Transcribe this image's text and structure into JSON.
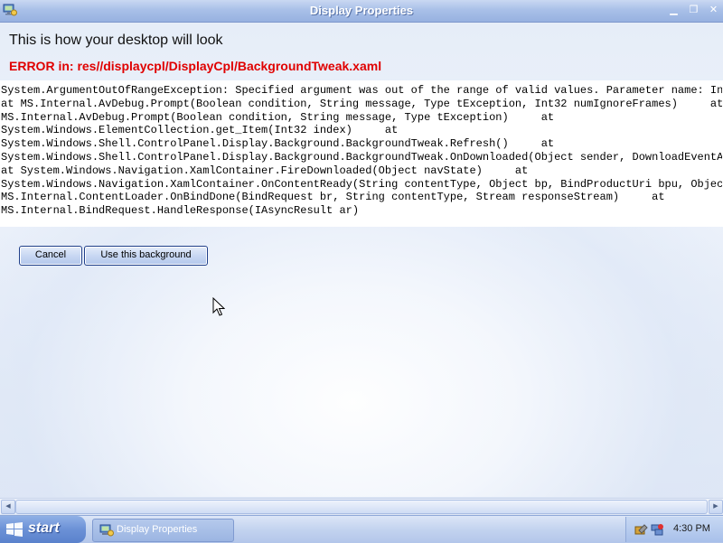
{
  "window": {
    "title": "Display Properties",
    "icon": "display-properties-icon",
    "controls": {
      "minimize_icon": "minimize-icon",
      "maximize_icon": "maximize-icon",
      "close_icon": "close-icon",
      "minimize_glyph": "▁",
      "maximize_glyph": "❐",
      "close_glyph": "✕"
    }
  },
  "main": {
    "heading": "This is how your desktop will look",
    "error_title": "ERROR in: res//displaycpl/DisplayCpl/BackgroundTweak.xaml",
    "stack_trace_lines": [
      "System.ArgumentOutOfRangeException: Specified argument was out of the range of valid values. Parameter name: Index out of range",
      "at MS.Internal.AvDebug.Prompt(Boolean condition, String message, Type tException, Int32 numIgnoreFrames)     at",
      "MS.Internal.AvDebug.Prompt(Boolean condition, String message, Type tException)     at",
      "System.Windows.ElementCollection.get_Item(Int32 index)     at",
      "System.Windows.Shell.ControlPanel.Display.Background.BackgroundTweak.Refresh()     at",
      "System.Windows.Shell.ControlPanel.Display.Background.BackgroundTweak.OnDownloaded(Object sender, DownloadEventArgs args)",
      "at System.Windows.Navigation.XamlContainer.FireDownloaded(Object navState)     at",
      "System.Windows.Navigation.XamlContainer.OnContentReady(String contentType, Object bp, BindProductUri bpu, Object navState)     at",
      "MS.Internal.ContentLoader.OnBindDone(BindRequest br, String contentType, Stream responseStream)     at",
      "MS.Internal.BindRequest.HandleResponse(IAsyncResult ar)"
    ],
    "buttons": {
      "cancel": "Cancel",
      "use_background": "Use this background"
    }
  },
  "scrollbar": {
    "left_arrow": "◀",
    "right_arrow": "▶"
  },
  "taskbar": {
    "start_label": "start",
    "start_icon": "windows-logo-icon",
    "task_button_label": "Display Properties",
    "task_button_icon": "display-properties-icon",
    "tray_icons": [
      "hardware-icon",
      "network-icon"
    ],
    "clock": "4:30 PM"
  },
  "colors": {
    "error_red": "#e00000",
    "titlebar_blue": "#a9c0e8",
    "taskbar_blue": "#c3d3ef"
  }
}
